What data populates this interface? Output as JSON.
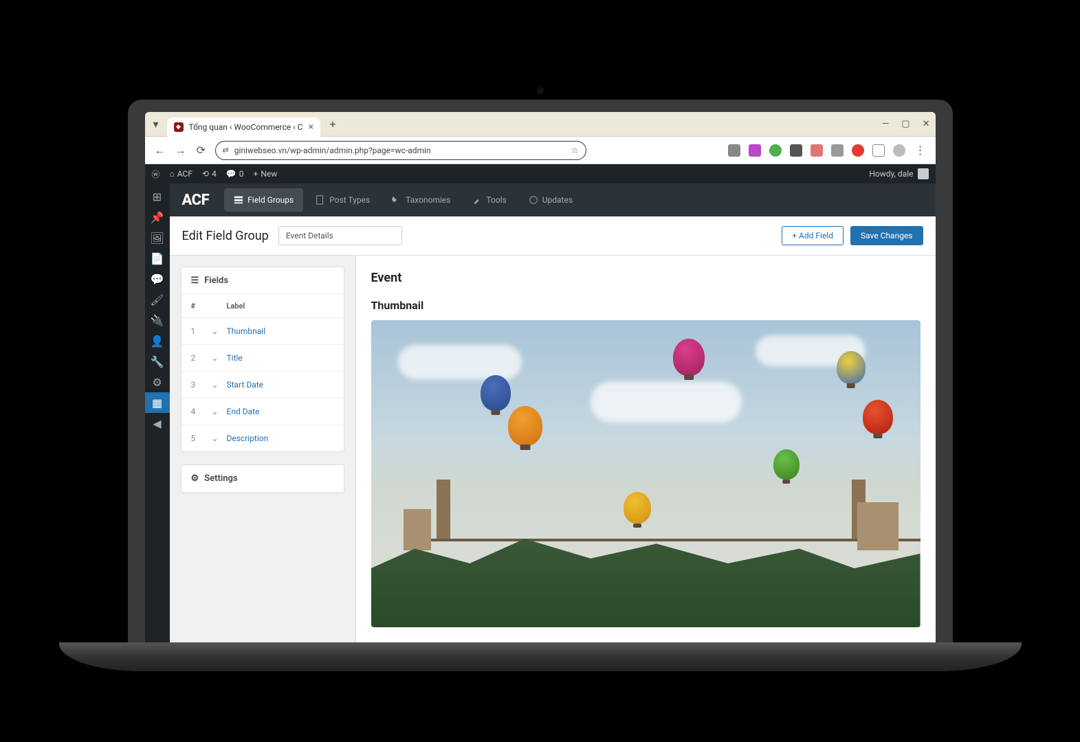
{
  "browser": {
    "tab_title": "Tổng quan ‹ WooCommerce ‹ C",
    "url": "giniwebseo.vn/wp-admin/admin.php?page=wc-admin"
  },
  "wp_adminbar": {
    "site_name": "ACF",
    "updates_count": "4",
    "comments_count": "0",
    "new_label": "New",
    "howdy": "Howdy, dale"
  },
  "acf_nav": {
    "logo": "ACF",
    "items": [
      {
        "label": "Field Groups"
      },
      {
        "label": "Post Types"
      },
      {
        "label": "Taxonomies"
      },
      {
        "label": "Tools"
      },
      {
        "label": "Updates"
      }
    ]
  },
  "page": {
    "title": "Edit Field Group",
    "group_name": "Event Details",
    "add_field": "+  Add Field",
    "save": "Save Changes"
  },
  "fields_panel": {
    "title": "Fields",
    "col_num": "#",
    "col_label": "Label",
    "rows": [
      {
        "num": "1",
        "label": "Thumbnail"
      },
      {
        "num": "2",
        "label": "Title"
      },
      {
        "num": "3",
        "label": "Start Date"
      },
      {
        "num": "4",
        "label": "End Date"
      },
      {
        "num": "5",
        "label": "Description"
      }
    ]
  },
  "settings_panel": {
    "title": "Settings"
  },
  "preview": {
    "heading": "Event",
    "field_label": "Thumbnail"
  }
}
